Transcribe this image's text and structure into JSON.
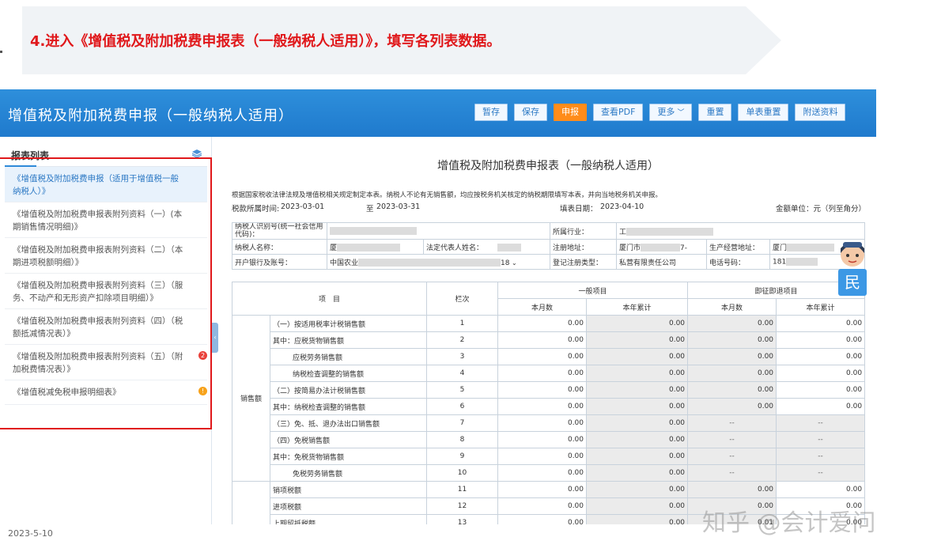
{
  "step_banner": {
    "text": "4.进入《增值税及附加税费申报表（一般纳税人适用）》，填写各列表数据。"
  },
  "app": {
    "title": "增值税及附加税费申报（一般纳税人适用）",
    "toolbar": [
      "暂存",
      "保存",
      "申报",
      "查看PDF",
      "更多",
      "重置",
      "单表重置",
      "附送资料"
    ],
    "primary_index": 2
  },
  "report_list": {
    "heading": "报表列表",
    "items": [
      {
        "label": "《增值税及附加税费申报（适用于增值税一般纳税人）》",
        "active": true,
        "badge": ""
      },
      {
        "label": "《增值税及附加税费申报表附列资料（一）(本期销售情况明细)》",
        "active": false,
        "badge": ""
      },
      {
        "label": "《增值税及附加税费申报表附列资料（二）（本期进项税额明细）》",
        "active": false,
        "badge": ""
      },
      {
        "label": "《增值税及附加税费申报表附列资料（三）（服务、不动产和无形资产扣除项目明细）》",
        "active": false,
        "badge": ""
      },
      {
        "label": "《增值税及附加税费申报表附列资料（四）（税额抵减情况表）》",
        "active": false,
        "badge": ""
      },
      {
        "label": "《增值税及附加税费申报表附列资料（五）（附加税费情况表）》",
        "active": false,
        "badge": "2"
      },
      {
        "label": "《增值税减免税申报明细表》",
        "active": false,
        "badge": "!"
      }
    ]
  },
  "form": {
    "title": "增值税及附加税费申报表（一般纳税人适用）",
    "notice": "根据国家税收法律法规及增值税相关规定制定本表。纳税人不论有无销售额，均应按税务机关核定的纳税期限填写本表，并向当地税务机关申报。",
    "period_label": "税款所属时间:",
    "period_start": "2023-03-01",
    "period_to": "至",
    "period_end": "2023-03-31",
    "fill_date_label": "填表日期：",
    "fill_date": "2023-04-10",
    "unit": "金额单位：元（列至角分）",
    "info": {
      "taxpayer_id_label": "纳税人识别号(统一社会信用代码)：",
      "industry_label": "所属行业：",
      "industry_value": "工",
      "name_label": "纳税人名称：",
      "name_value": "厦",
      "legal_rep_label": "法定代表人姓名：",
      "reg_addr_label": "注册地址：",
      "reg_addr_value": "厦门市",
      "reg_addr_suffix": "7-",
      "biz_addr_label": "生产经营地址：",
      "biz_addr_value": "厦门",
      "bank_label": "开户银行及账号：",
      "bank_value": "中国农业",
      "bank_suffix": "18",
      "reg_type_label": "登记注册类型：",
      "reg_type_value": "私营有限责任公司",
      "phone_label": "电话号码：",
      "phone_value": "181"
    },
    "table": {
      "col_item": "项　目",
      "col_line": "栏次",
      "col_general": "一般项目",
      "col_refund": "即征即退项目",
      "col_month": "本月数",
      "col_year": "本年累计",
      "group_sales": "销售额",
      "rows": [
        {
          "label": "（一）按适用税率计税销售额",
          "line": "1",
          "v": [
            "0.00",
            "0.00",
            "0.00",
            "0.00"
          ],
          "indent": 0
        },
        {
          "label": "其中：应税货物销售额",
          "line": "2",
          "v": [
            "0.00",
            "0.00",
            "0.00",
            "0.00"
          ],
          "indent": 0
        },
        {
          "label": "应税劳务销售额",
          "line": "3",
          "v": [
            "0.00",
            "0.00",
            "0.00",
            "0.00"
          ],
          "indent": 1
        },
        {
          "label": "纳税检查调整的销售额",
          "line": "4",
          "v": [
            "0.00",
            "0.00",
            "0.00",
            "0.00"
          ],
          "indent": 1
        },
        {
          "label": "（二）按简易办法计税销售额",
          "line": "5",
          "v": [
            "0.00",
            "0.00",
            "0.00",
            "0.00"
          ],
          "indent": 0
        },
        {
          "label": "其中：纳税检查调整的销售额",
          "line": "6",
          "v": [
            "0.00",
            "0.00",
            "0.00",
            "0.00"
          ],
          "indent": 0
        },
        {
          "label": "（三）免、抵、退办法出口销售额",
          "line": "7",
          "v": [
            "0.00",
            "0.00",
            "--",
            "--"
          ],
          "indent": 0
        },
        {
          "label": "（四）免税销售额",
          "line": "8",
          "v": [
            "0.00",
            "0.00",
            "--",
            "--"
          ],
          "indent": 0
        },
        {
          "label": "其中：免税货物销售额",
          "line": "9",
          "v": [
            "0.00",
            "0.00",
            "--",
            "--"
          ],
          "indent": 0
        },
        {
          "label": "免税劳务销售额",
          "line": "10",
          "v": [
            "0.00",
            "0.00",
            "--",
            "--"
          ],
          "indent": 1
        },
        {
          "label": "销项税额",
          "line": "11",
          "v": [
            "0.00",
            "0.00",
            "0.00",
            "0.00"
          ],
          "indent": 0
        },
        {
          "label": "进项税额",
          "line": "12",
          "v": [
            "0.00",
            "0.00",
            "0.00",
            "0.00"
          ],
          "indent": 0
        },
        {
          "label": "上期留抵税额",
          "line": "13",
          "v": [
            "0.00",
            "0.00",
            "0.01",
            "0.00"
          ],
          "indent": 0
        }
      ]
    }
  },
  "assistant": {
    "glyph": "民"
  },
  "footer": {
    "date": "2023-5-10"
  },
  "watermark": "知乎 @会计爱问",
  "colors": {
    "header_blue": "#1f7acd",
    "primary_orange": "#ff8c1a",
    "alert_red": "#e0181b"
  }
}
